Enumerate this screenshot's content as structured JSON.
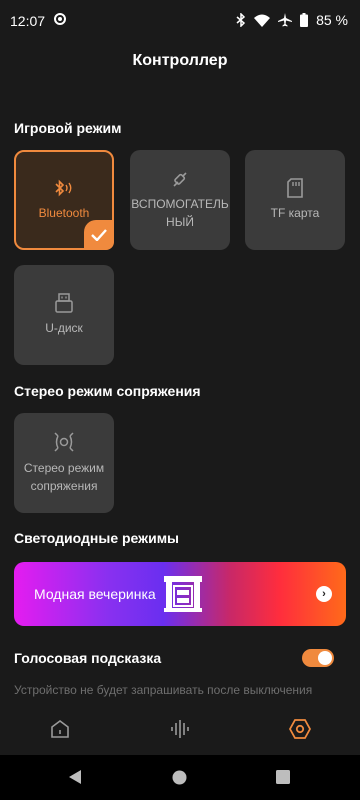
{
  "status": {
    "time": "12:07",
    "battery": "85 %"
  },
  "header": {
    "title": "Контроллер"
  },
  "game_mode": {
    "title": "Игровой режим",
    "items": [
      {
        "label": "Bluetooth",
        "icon": "bluetooth-audio-icon",
        "selected": true
      },
      {
        "label": "ВСПОМОГАТЕЛЬНЫЙ",
        "label_line1": "ВСПОМОГАТЕЛЬ",
        "label_line2": "НЫЙ",
        "icon": "aux-cable-icon",
        "selected": false
      },
      {
        "label": "TF карта",
        "icon": "sd-card-icon",
        "selected": false
      },
      {
        "label": "U-диск",
        "icon": "usb-drive-icon",
        "selected": false
      }
    ]
  },
  "stereo": {
    "title": "Стерео режим сопряжения",
    "item": {
      "label_line1": "Стерео режим",
      "label_line2": "сопряжения",
      "icon": "stereo-pair-icon"
    }
  },
  "led": {
    "title": "Светодиодные режимы",
    "card_label": "Модная вечеринка",
    "gradient": [
      "#e51cf0",
      "#6a2ff0",
      "#ff2d3d",
      "#ff6a1a"
    ]
  },
  "voice": {
    "title": "Голосовая подсказка",
    "enabled": true,
    "hint": "Устройство не будет запрашивать после выключения"
  },
  "colors": {
    "accent": "#f08a3e",
    "background": "#1a1a1a",
    "tile": "#3b3b3b"
  },
  "bottom_nav": [
    "home-icon",
    "equalizer-icon",
    "settings-hex-icon"
  ]
}
